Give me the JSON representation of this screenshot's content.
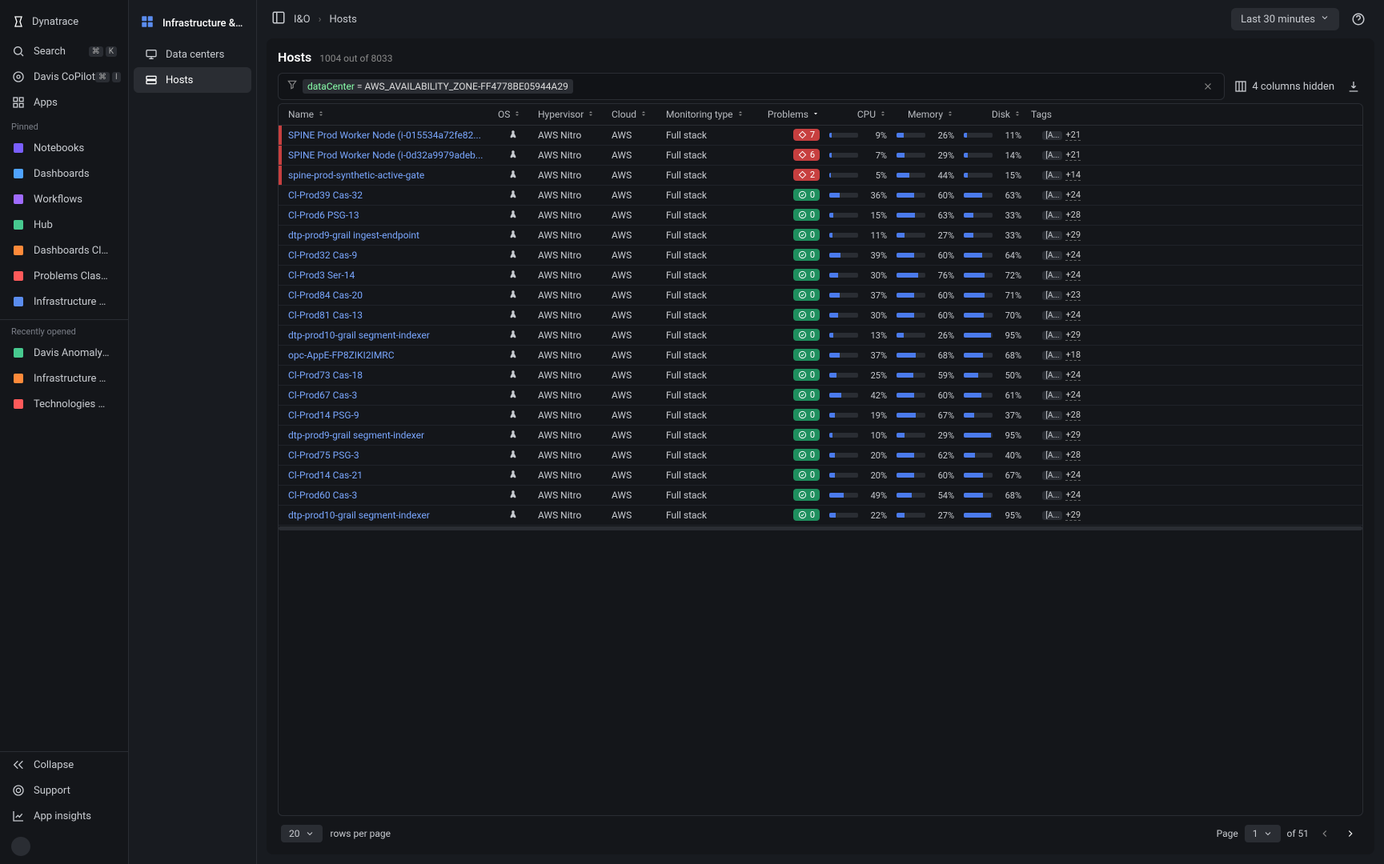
{
  "brand": "Dynatrace",
  "sidebar": {
    "search": "Search",
    "copilot": "Davis CoPilot",
    "apps": "Apps",
    "shortcut_cmd": "⌘",
    "shortcut_k": "K",
    "shortcut_i": "I",
    "pinned_label": "Pinned",
    "pinned": [
      "Notebooks",
      "Dashboards",
      "Workflows",
      "Hub",
      "Dashboards Classic",
      "Problems Classic",
      "Infrastructure & Opera..."
    ],
    "recent_label": "Recently opened",
    "recent": [
      "Davis Anomaly Detection",
      "Infrastructure & Opera...",
      "Technologies & Proces..."
    ],
    "collapse": "Collapse",
    "support": "Support",
    "insights": "App insights"
  },
  "panel2": {
    "title": "Infrastructure & Operations",
    "items": [
      {
        "label": "Data centers"
      },
      {
        "label": "Hosts"
      }
    ],
    "active_index": 1
  },
  "topbar": {
    "crumb_root": "I&O",
    "crumb_leaf": "Hosts",
    "time": "Last 30 minutes"
  },
  "content": {
    "title": "Hosts",
    "subtitle": "1004 out of 8033",
    "filter": {
      "key": "dataCenter",
      "op": "=",
      "val": "AWS_AVAILABILITY_ZONE-FF4778BE05944A29"
    },
    "columns_hidden": "4 columns hidden",
    "pager": {
      "rows_per_page": "20",
      "rpp_label": "rows per page",
      "page_label": "Page",
      "page": "1",
      "of_label": "of 51"
    }
  },
  "columns": [
    "Name",
    "OS",
    "Hypervisor",
    "Cloud",
    "Monitoring type",
    "Problems",
    "CPU",
    "Memory",
    "Disk",
    "Tags"
  ],
  "rows": [
    {
      "err": true,
      "name": "SPINE Prod Worker Node (i-015534a72fe82...",
      "hv": "AWS Nitro",
      "cloud": "AWS",
      "mon": "Full stack",
      "prob": 7,
      "cpu": 9,
      "mem": 26,
      "disk": 11,
      "tag": "[A...",
      "more": "+21"
    },
    {
      "err": true,
      "name": "SPINE Prod Worker Node (i-0d32a9979adeb...",
      "hv": "AWS Nitro",
      "cloud": "AWS",
      "mon": "Full stack",
      "prob": 6,
      "cpu": 7,
      "mem": 29,
      "disk": 14,
      "tag": "[A...",
      "more": "+21"
    },
    {
      "err": true,
      "name": "spine-prod-synthetic-active-gate",
      "hv": "AWS Nitro",
      "cloud": "AWS",
      "mon": "Full stack",
      "prob": 2,
      "cpu": 5,
      "mem": 44,
      "disk": 15,
      "tag": "[A...",
      "more": "+14"
    },
    {
      "err": false,
      "name": "Cl-Prod39 Cas-32",
      "hv": "AWS Nitro",
      "cloud": "AWS",
      "mon": "Full stack",
      "prob": 0,
      "cpu": 36,
      "mem": 60,
      "disk": 63,
      "tag": "[A...",
      "more": "+24"
    },
    {
      "err": false,
      "name": "Cl-Prod6 PSG-13",
      "hv": "AWS Nitro",
      "cloud": "AWS",
      "mon": "Full stack",
      "prob": 0,
      "cpu": 15,
      "mem": 63,
      "disk": 33,
      "tag": "[A...",
      "more": "+28"
    },
    {
      "err": false,
      "name": "dtp-prod9-grail ingest-endpoint",
      "hv": "AWS Nitro",
      "cloud": "AWS",
      "mon": "Full stack",
      "prob": 0,
      "cpu": 11,
      "mem": 27,
      "disk": 33,
      "tag": "[A...",
      "more": "+29"
    },
    {
      "err": false,
      "name": "Cl-Prod32 Cas-9",
      "hv": "AWS Nitro",
      "cloud": "AWS",
      "mon": "Full stack",
      "prob": 0,
      "cpu": 39,
      "mem": 60,
      "disk": 64,
      "tag": "[A...",
      "more": "+24"
    },
    {
      "err": false,
      "name": "Cl-Prod3 Ser-14",
      "hv": "AWS Nitro",
      "cloud": "AWS",
      "mon": "Full stack",
      "prob": 0,
      "cpu": 30,
      "mem": 76,
      "disk": 72,
      "tag": "[A...",
      "more": "+24"
    },
    {
      "err": false,
      "name": "Cl-Prod84 Cas-20",
      "hv": "AWS Nitro",
      "cloud": "AWS",
      "mon": "Full stack",
      "prob": 0,
      "cpu": 37,
      "mem": 60,
      "disk": 71,
      "tag": "[A...",
      "more": "+23"
    },
    {
      "err": false,
      "name": "Cl-Prod81 Cas-13",
      "hv": "AWS Nitro",
      "cloud": "AWS",
      "mon": "Full stack",
      "prob": 0,
      "cpu": 30,
      "mem": 60,
      "disk": 70,
      "tag": "[A...",
      "more": "+24"
    },
    {
      "err": false,
      "name": "dtp-prod10-grail segment-indexer",
      "hv": "AWS Nitro",
      "cloud": "AWS",
      "mon": "Full stack",
      "prob": 0,
      "cpu": 13,
      "mem": 26,
      "disk": 95,
      "tag": "[A...",
      "more": "+29"
    },
    {
      "err": false,
      "name": "opc-AppE-FP8ZIKI2IMRC",
      "hv": "AWS Nitro",
      "cloud": "AWS",
      "mon": "Full stack",
      "prob": 0,
      "cpu": 37,
      "mem": 68,
      "disk": 68,
      "tag": "[A...",
      "more": "+18"
    },
    {
      "err": false,
      "name": "Cl-Prod73 Cas-18",
      "hv": "AWS Nitro",
      "cloud": "AWS",
      "mon": "Full stack",
      "prob": 0,
      "cpu": 25,
      "mem": 59,
      "disk": 50,
      "tag": "[A...",
      "more": "+24"
    },
    {
      "err": false,
      "name": "Cl-Prod67 Cas-3",
      "hv": "AWS Nitro",
      "cloud": "AWS",
      "mon": "Full stack",
      "prob": 0,
      "cpu": 42,
      "mem": 60,
      "disk": 61,
      "tag": "[A...",
      "more": "+24"
    },
    {
      "err": false,
      "name": "Cl-Prod14 PSG-9",
      "hv": "AWS Nitro",
      "cloud": "AWS",
      "mon": "Full stack",
      "prob": 0,
      "cpu": 19,
      "mem": 67,
      "disk": 37,
      "tag": "[A...",
      "more": "+28"
    },
    {
      "err": false,
      "name": "dtp-prod9-grail segment-indexer",
      "hv": "AWS Nitro",
      "cloud": "AWS",
      "mon": "Full stack",
      "prob": 0,
      "cpu": 10,
      "mem": 29,
      "disk": 95,
      "tag": "[A...",
      "more": "+29"
    },
    {
      "err": false,
      "name": "Cl-Prod75 PSG-3",
      "hv": "AWS Nitro",
      "cloud": "AWS",
      "mon": "Full stack",
      "prob": 0,
      "cpu": 20,
      "mem": 62,
      "disk": 40,
      "tag": "[A...",
      "more": "+28"
    },
    {
      "err": false,
      "name": "Cl-Prod14 Cas-21",
      "hv": "AWS Nitro",
      "cloud": "AWS",
      "mon": "Full stack",
      "prob": 0,
      "cpu": 20,
      "mem": 60,
      "disk": 67,
      "tag": "[A...",
      "more": "+24"
    },
    {
      "err": false,
      "name": "Cl-Prod60 Cas-3",
      "hv": "AWS Nitro",
      "cloud": "AWS",
      "mon": "Full stack",
      "prob": 0,
      "cpu": 49,
      "mem": 54,
      "disk": 68,
      "tag": "[A...",
      "more": "+24"
    },
    {
      "err": false,
      "name": "dtp-prod10-grail segment-indexer",
      "hv": "AWS Nitro",
      "cloud": "AWS",
      "mon": "Full stack",
      "prob": 0,
      "cpu": 22,
      "mem": 27,
      "disk": 95,
      "tag": "[A...",
      "more": "+29"
    }
  ]
}
